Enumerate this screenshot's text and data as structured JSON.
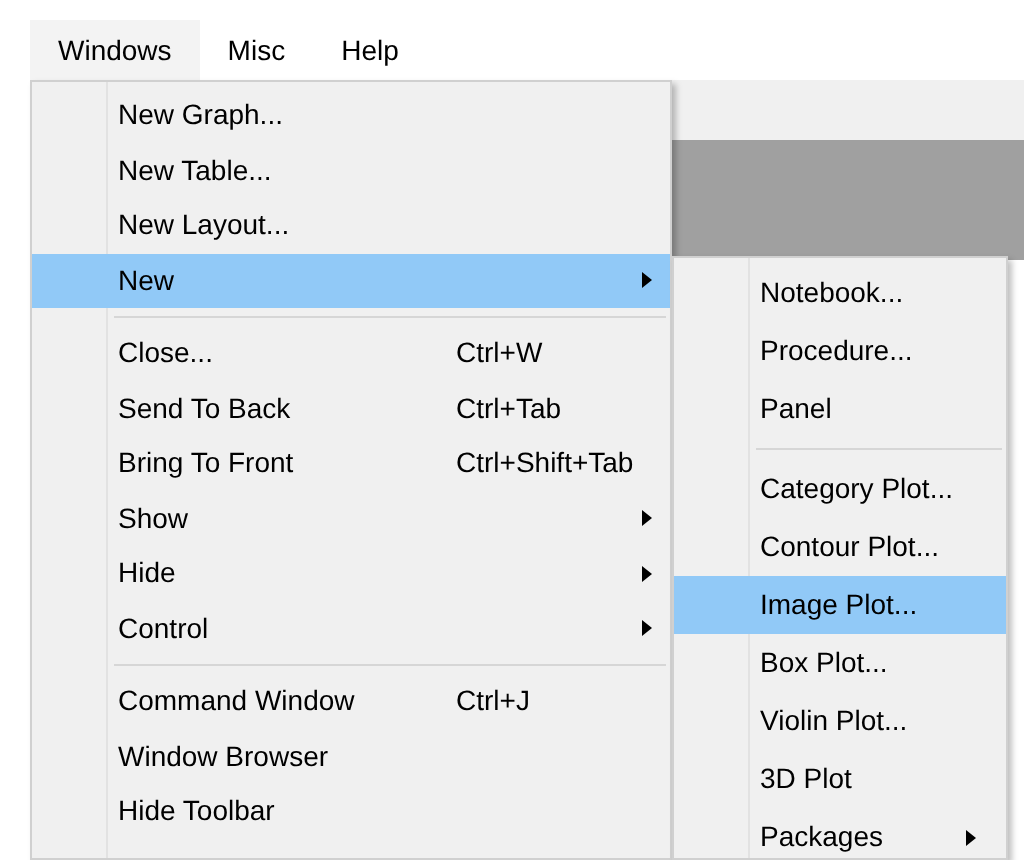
{
  "menubar": [
    {
      "label": "Windows",
      "selected": true
    },
    {
      "label": "Misc",
      "selected": false
    },
    {
      "label": "Help",
      "selected": false
    }
  ],
  "menu": {
    "items": [
      {
        "kind": "item",
        "label": "New Graph...",
        "selected": false
      },
      {
        "kind": "item",
        "label": "New Table...",
        "selected": false
      },
      {
        "kind": "item",
        "label": "New Layout...",
        "selected": false
      },
      {
        "kind": "item",
        "label": "New",
        "submenu": true,
        "selected": true
      },
      {
        "kind": "separator"
      },
      {
        "kind": "item",
        "label": "Close...",
        "shortcut": "Ctrl+W",
        "selected": false
      },
      {
        "kind": "item",
        "label": "Send To Back",
        "shortcut": "Ctrl+Tab",
        "selected": false
      },
      {
        "kind": "item",
        "label": "Bring To Front",
        "shortcut": "Ctrl+Shift+Tab",
        "selected": false
      },
      {
        "kind": "item",
        "label": "Show",
        "submenu": true,
        "selected": false
      },
      {
        "kind": "item",
        "label": "Hide",
        "submenu": true,
        "selected": false
      },
      {
        "kind": "item",
        "label": "Control",
        "submenu": true,
        "selected": false
      },
      {
        "kind": "separator"
      },
      {
        "kind": "item",
        "label": "Command Window",
        "shortcut": "Ctrl+J",
        "selected": false
      },
      {
        "kind": "item",
        "label": "Window Browser",
        "selected": false
      },
      {
        "kind": "item",
        "label": "Hide Toolbar",
        "selected": false
      }
    ]
  },
  "submenu": {
    "items": [
      {
        "kind": "item",
        "label": "Notebook...",
        "selected": false
      },
      {
        "kind": "item",
        "label": "Procedure...",
        "selected": false
      },
      {
        "kind": "item",
        "label": "Panel",
        "selected": false
      },
      {
        "kind": "separator"
      },
      {
        "kind": "item",
        "label": "Category Plot...",
        "selected": false
      },
      {
        "kind": "item",
        "label": "Contour Plot...",
        "selected": false
      },
      {
        "kind": "item",
        "label": "Image Plot...",
        "selected": true
      },
      {
        "kind": "item",
        "label": "Box Plot...",
        "selected": false
      },
      {
        "kind": "item",
        "label": "Violin Plot...",
        "selected": false
      },
      {
        "kind": "item",
        "label": "3D Plot",
        "selected": false
      },
      {
        "kind": "item",
        "label": "Packages",
        "submenu": true,
        "selected": false
      }
    ]
  }
}
